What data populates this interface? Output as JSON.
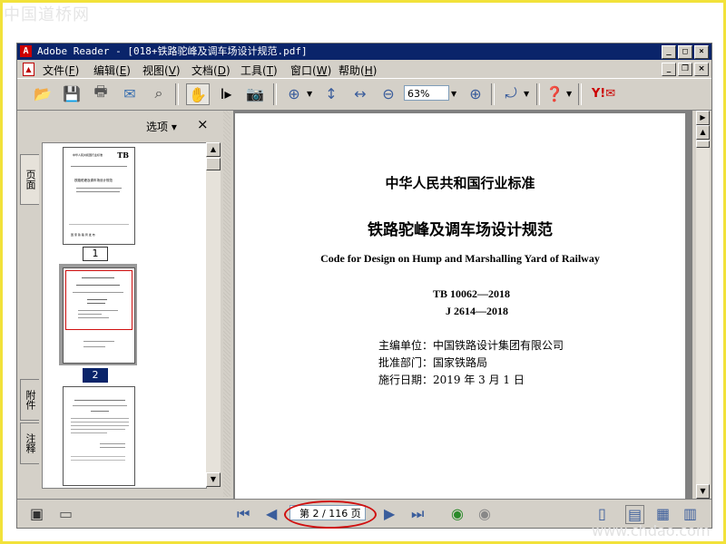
{
  "watermark": {
    "top": "中国道桥网",
    "bottom": "www.chdao.com"
  },
  "window": {
    "title": "Adobe Reader - [018+铁路驼峰及调车场设计规范.pdf]",
    "app_icon": "adobe-reader-icon"
  },
  "menu": {
    "items": [
      {
        "label": "文件",
        "key": "F"
      },
      {
        "label": "编辑",
        "key": "E"
      },
      {
        "label": "视图",
        "key": "V"
      },
      {
        "label": "文档",
        "key": "D"
      },
      {
        "label": "工具",
        "key": "T"
      },
      {
        "label": "窗口",
        "key": "W"
      },
      {
        "label": "帮助",
        "key": "H"
      }
    ]
  },
  "toolbar": {
    "zoom_value": "63%",
    "icons": [
      "open-icon",
      "save-icon",
      "print-icon",
      "email-icon",
      "search-icon",
      "hand-icon",
      "select-text-icon",
      "snapshot-icon",
      "zoom-in-tool-icon",
      "fit-page-icon",
      "fit-width-icon",
      "zoom-out-icon",
      "zoom-plus-icon",
      "rotate-icon",
      "help-icon",
      "yahoo-icon"
    ]
  },
  "nav": {
    "tabs": [
      "页面",
      "附件",
      "注释"
    ],
    "options_label": "选项",
    "thumbnails": [
      {
        "num": "1",
        "selected": false
      },
      {
        "num": "2",
        "selected": true
      },
      {
        "num": "",
        "selected": false
      }
    ]
  },
  "document": {
    "heading": "中华人民共和国行业标准",
    "title_cn": "铁路驼峰及调车场设计规范",
    "title_en": "Code for Design on Hump and Marshalling Yard of Railway",
    "code1": "TB 10062—2018",
    "code2": "J 2614—2018",
    "info": [
      "主编单位：中国铁路设计集团有限公司",
      "批准部门：国家铁路局",
      "施行日期：2019 年 3 月 1 日"
    ]
  },
  "thumb_page1": {
    "tb": "TB",
    "line1": "中华人民共和国行业标准",
    "line2": "铁路驼峰及调车场设计规范",
    "footer": "国 家 铁 路 局   发 布"
  },
  "status": {
    "page_indicator": "第 2 / 116 页"
  }
}
